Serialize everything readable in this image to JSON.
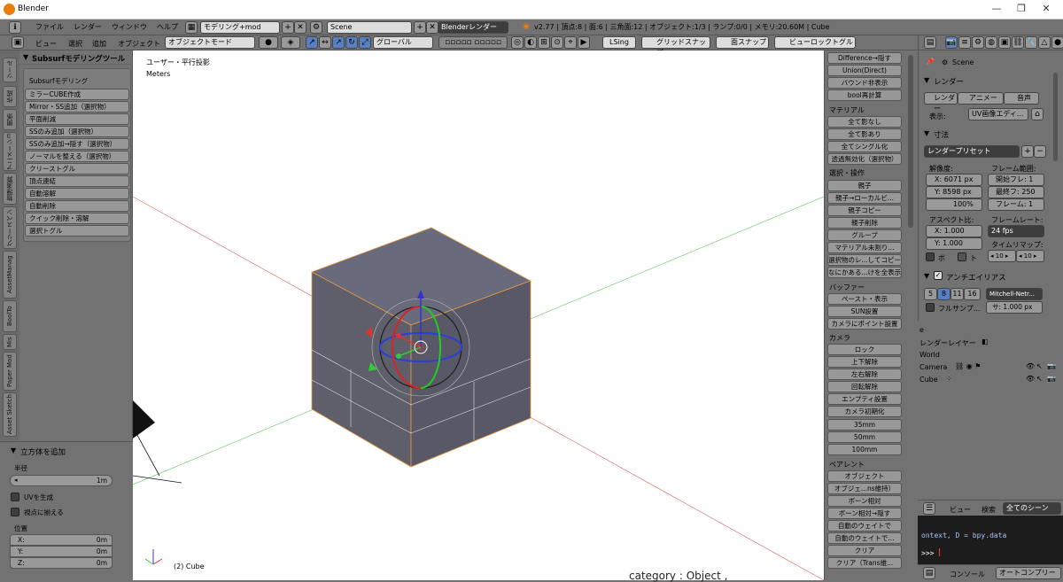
{
  "window": {
    "title": "Blender"
  },
  "menu": {
    "items": [
      "ファイル",
      "レンダー",
      "ウィンドウ",
      "ヘルプ"
    ],
    "screen": "モデリング+mod",
    "scene": "Scene",
    "engine": "Blenderレンダー",
    "info": "v2.77 | 頂点:8 | 面:6 | 三角面:12 | オブジェクト:1/3 | ランプ:0/0 | メモリ:20.60M | Cube"
  },
  "toolbar3d": {
    "view": "ビュー",
    "select": "選択",
    "add": "追加",
    "object": "オブジェクト",
    "mode": "オブジェクトモード",
    "orientation": "グローバル",
    "lsing": "LSing",
    "grid_snap": "グリッドスナップ",
    "surface_snap": "面スナップ",
    "view_lock": "ビューロックトグル"
  },
  "left_tabs": [
    "ツール",
    "作成",
    "関係",
    "アニメーション",
    "物理演算",
    "グリースペンシル",
    "AssetManag",
    "BoolTo",
    "Mis",
    "Paper Mod",
    "Asset Sketch"
  ],
  "left_panel": {
    "title": "Subsurfモデリングツール",
    "subtitle": "Subsurfモデリング",
    "buttons": [
      "ミラーCUBE作成",
      "Mirror・SS追加（選択物）",
      "平面削減",
      "SSのみ追加（選択物）",
      "SSのみ追加→隠す（選択物）",
      "ノーマルを整える（選択物）",
      "クリーストグル",
      "頂点連結",
      "自動溶解",
      "自動削除",
      "クイック削除・溶解",
      "選択トグル"
    ]
  },
  "operator_panel": {
    "title": "立方体を追加",
    "radius_label": "半径",
    "radius_value": "1m",
    "uv_label": "UVを生成",
    "align_label": "視点に揃える",
    "location_label": "位置",
    "x_label": "X:",
    "x_value": "0m",
    "y_label": "Y:",
    "y_value": "0m",
    "z_label": "Z:",
    "z_value": "0m"
  },
  "viewport": {
    "view_name": "ユーザー・平行投影",
    "units": "Meters",
    "object_label": "(2) Cube",
    "bg_text": "category : Object ,"
  },
  "right_column": {
    "top_buttons": [
      "Difference→隠す",
      "Union(Direct)",
      "バウンド非表示",
      "bool再計算"
    ],
    "material_header": "マテリアル",
    "material_buttons": [
      "全て影なし",
      "全て影あり",
      "全てシングル化",
      "透過無効化（選択物）"
    ],
    "select_header": "選択・操作",
    "select_buttons": [
      "親子",
      "親子→ローカルビ...",
      "親子コピー",
      "親子削除",
      "グループ",
      "マテリアル未割り...",
      "選択物のレ...してコピー",
      "なにかある...けを全表示"
    ],
    "buffer_header": "バッファー",
    "buffer_buttons": [
      "ペースト・表示",
      "SUN設置",
      "カメラにポイント設置"
    ],
    "camera_header": "カメラ",
    "camera_buttons": [
      "ロック",
      "上下解除",
      "左右解除",
      "回転解除",
      "エンプティ設置",
      "カメラ初期化",
      "35mm",
      "50mm",
      "100mm"
    ],
    "parent_header": "ペアレント",
    "parent_buttons": [
      "オブジェクト",
      "オブジェ...ns維持）",
      "ボーン相対",
      "ボーン相対→隠す",
      "自動のウェイトで",
      "自動のウェイトで...",
      "クリア",
      "クリア（Trans維..."
    ]
  },
  "properties": {
    "scene": "Scene",
    "render_title": "レンダー",
    "render_btn": "レンダー",
    "anim_btn": "アニメー",
    "audio_btn": "音声",
    "display_label": "表示:",
    "display_value": "UV画像エディ...",
    "dims_title": "寸法",
    "preset": "レンダープリセット",
    "resolution_label": "解像度:",
    "res_x": "X:  6071 px",
    "res_y": "Y:  8598 px",
    "res_pct": "100%",
    "frame_range_label": "フレーム範囲:",
    "frame_start": "開始フレ: 1",
    "frame_end": "最終フ: 250",
    "frame_step": "フレーム: 1",
    "aspect_label": "アスペクト比:",
    "asp_x": "X:      1.000",
    "asp_y": "Y:      1.000",
    "fps_label": "フレームレート:",
    "fps_value": "24 fps",
    "remap_label": "タイムリマップ:",
    "remap_old": "◂ 10 ▸",
    "remap_new": "◂ 10 ▸",
    "border_label": "ボ",
    "crop_label": "ト",
    "aa_title": "アンチエイリアス",
    "aa_samples": [
      "5",
      "8",
      "11",
      "16"
    ],
    "aa_filter": "Mitchell-Netr...",
    "full_sample": "フルサンプ...",
    "filter_size": "サ: 1.000 px"
  },
  "outliner": {
    "items": [
      "e",
      "レンダーレイヤー",
      "World",
      "Camera",
      "Cube"
    ],
    "view": "ビュー",
    "search": "検索",
    "scenes": "全てのシーン"
  },
  "console": {
    "line1": "ontext, D = bpy.data",
    "prompt": ">>> ",
    "tab_console": "コンソール",
    "tab_autocomplete": "オートコンプリー"
  }
}
